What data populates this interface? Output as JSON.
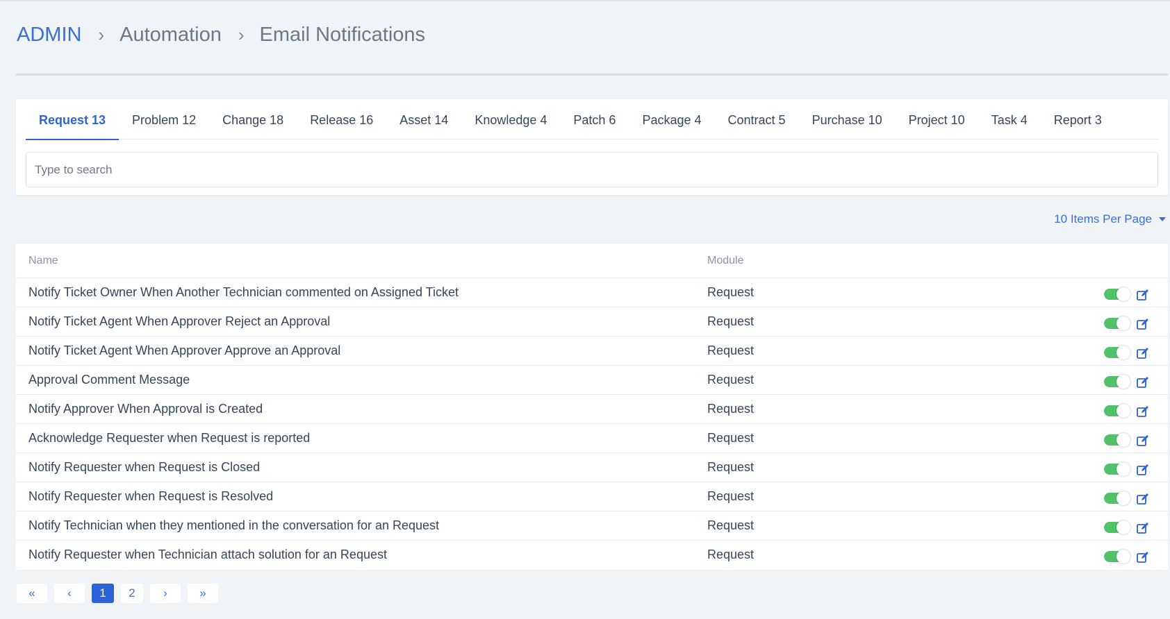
{
  "breadcrumb": {
    "root": "ADMIN",
    "separator": "›",
    "level1": "Automation",
    "current": "Email Notifications"
  },
  "tabs": [
    {
      "label": "Request 13",
      "active": true
    },
    {
      "label": "Problem 12"
    },
    {
      "label": "Change 18"
    },
    {
      "label": "Release 16"
    },
    {
      "label": "Asset 14"
    },
    {
      "label": "Knowledge 4"
    },
    {
      "label": "Patch 6"
    },
    {
      "label": "Package 4"
    },
    {
      "label": "Contract 5"
    },
    {
      "label": "Purchase 10"
    },
    {
      "label": "Project 10"
    },
    {
      "label": "Task 4"
    },
    {
      "label": "Report 3"
    }
  ],
  "search": {
    "placeholder": "Type to search",
    "value": ""
  },
  "per_page": {
    "label": "10 Items Per Page"
  },
  "table": {
    "headers": {
      "name": "Name",
      "module": "Module"
    },
    "rows": [
      {
        "name": "Notify Ticket Owner When Another Technician commented on Assigned Ticket",
        "module": "Request",
        "enabled": true
      },
      {
        "name": "Notify Ticket Agent When Approver Reject an Approval",
        "module": "Request",
        "enabled": true
      },
      {
        "name": "Notify Ticket Agent When Approver Approve an Approval",
        "module": "Request",
        "enabled": true
      },
      {
        "name": "Approval Comment Message",
        "module": "Request",
        "enabled": true
      },
      {
        "name": "Notify Approver When Approval is Created",
        "module": "Request",
        "enabled": true
      },
      {
        "name": "Acknowledge Requester when Request is reported",
        "module": "Request",
        "enabled": true
      },
      {
        "name": "Notify Requester when Request is Closed",
        "module": "Request",
        "enabled": true
      },
      {
        "name": "Notify Requester when Request is Resolved",
        "module": "Request",
        "enabled": true
      },
      {
        "name": "Notify Technician when they mentioned in the conversation for an Request",
        "module": "Request",
        "enabled": true
      },
      {
        "name": "Notify Requester when Technician attach solution for an Request",
        "module": "Request",
        "enabled": true
      }
    ]
  },
  "pagination": {
    "first": "«",
    "prev": "‹",
    "pages": [
      "1",
      "2"
    ],
    "current_page": "1",
    "next": "›",
    "last": "»"
  },
  "colors": {
    "accent": "#2c63d6",
    "toggle_on": "#52c26a",
    "background": "#f0f4f7"
  },
  "icons": {
    "breadcrumb_separator": "chevron-right-icon",
    "per_page_dropdown": "caret-down-icon",
    "row_edit": "edit-icon",
    "row_toggle": "toggle-switch"
  }
}
